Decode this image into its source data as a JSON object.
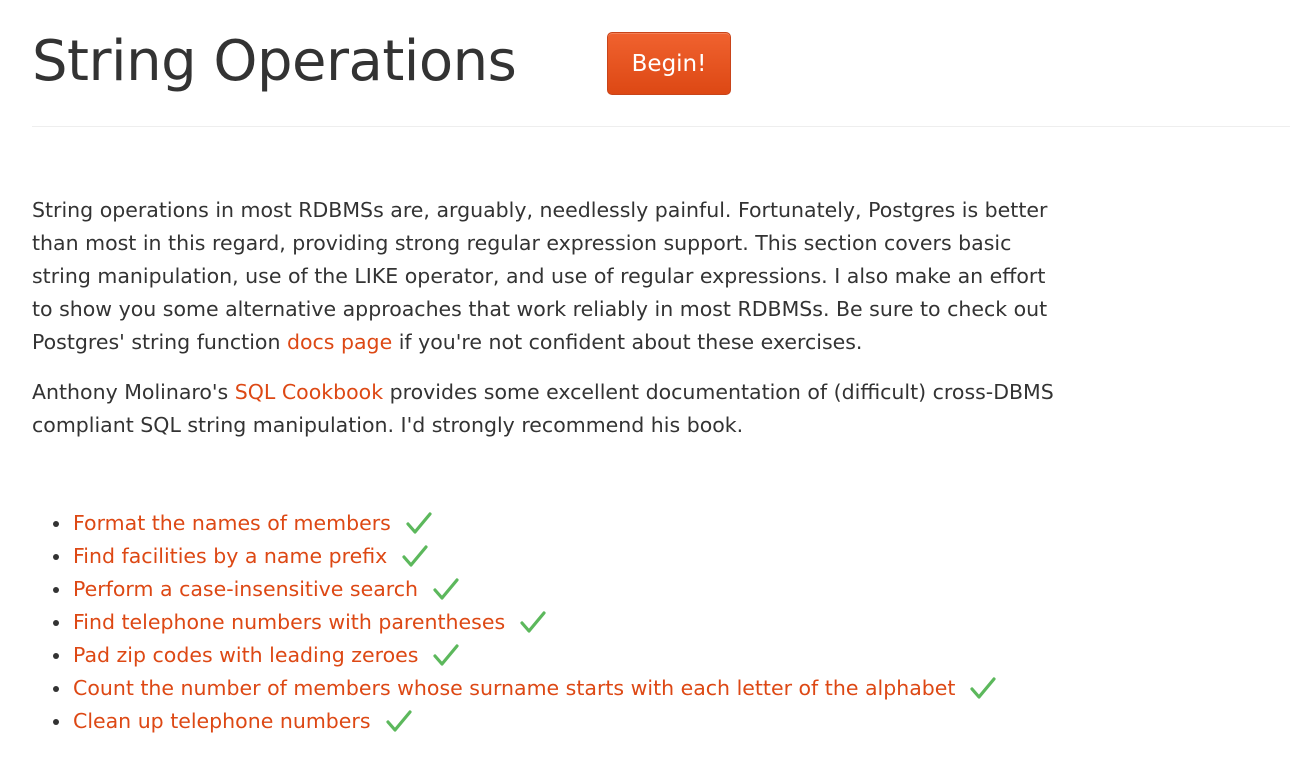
{
  "header": {
    "title": "String Operations",
    "begin_label": "Begin!"
  },
  "intro": {
    "p1_a": "String operations in most RDBMSs are, arguably, needlessly painful. Fortunately, Postgres is better than most in this regard, providing strong regular expression support. This section covers basic string manipulation, use of the LIKE operator, and use of regular expressions. I also make an effort to show you some alternative approaches that work reliably in most RDBMSs. Be sure to check out Postgres' string function ",
    "p1_link": "docs page",
    "p1_b": " if you're not confident about these exercises.",
    "p2_a": "Anthony Molinaro's ",
    "p2_link": "SQL Cookbook",
    "p2_b": " provides some excellent documentation of (difficult) cross-DBMS compliant SQL string manipulation. I'd strongly recommend his book."
  },
  "exercises": [
    {
      "label": "Format the names of members",
      "completed": true
    },
    {
      "label": "Find facilities by a name prefix",
      "completed": true
    },
    {
      "label": "Perform a case-insensitive search",
      "completed": true
    },
    {
      "label": "Find telephone numbers with parentheses",
      "completed": true
    },
    {
      "label": "Pad zip codes with leading zeroes",
      "completed": true
    },
    {
      "label": "Count the number of members whose surname starts with each letter of the alphabet",
      "completed": true
    },
    {
      "label": "Clean up telephone numbers",
      "completed": true
    }
  ],
  "colors": {
    "accent": "#dd4814",
    "check": "#5cb85c",
    "text": "#333333"
  },
  "icons": {
    "completed": "checkmark-icon"
  }
}
